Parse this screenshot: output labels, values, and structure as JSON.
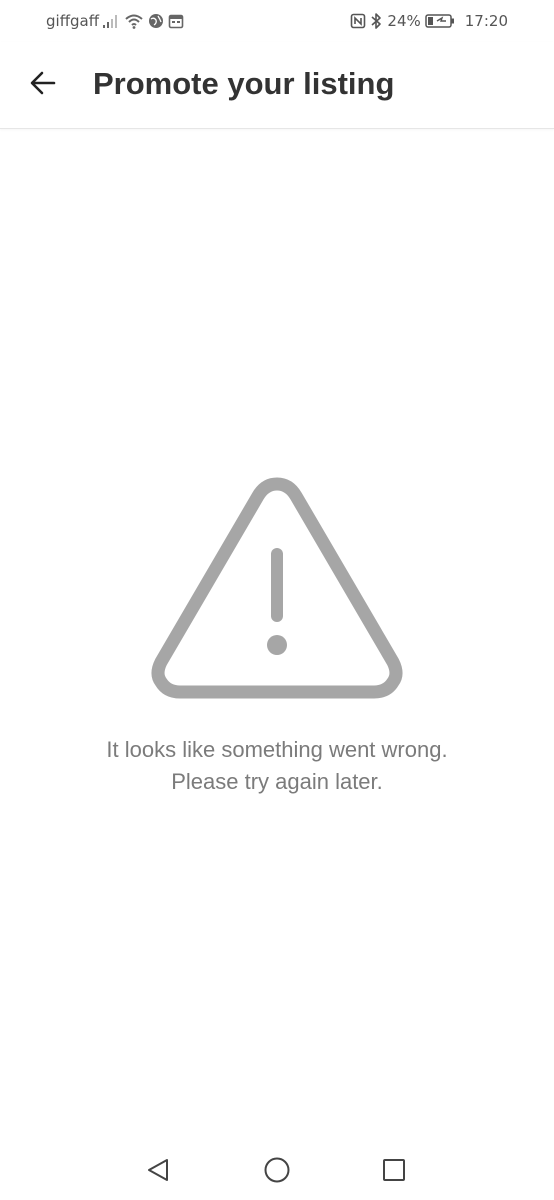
{
  "status_bar": {
    "carrier": "giffgaff",
    "battery_percent": "24%",
    "time": "17:20",
    "icons": [
      "signal-icon",
      "wifi-icon",
      "vpn-globe-icon",
      "calendar-icon",
      "nfc-icon",
      "bluetooth-icon",
      "battery-icon"
    ]
  },
  "app_bar": {
    "back_icon": "arrow-left-icon",
    "title": "Promote your listing"
  },
  "error": {
    "icon": "warning-triangle-icon",
    "line1": "It looks like something went wrong.",
    "line2": "Please try again later."
  },
  "nav_bar": {
    "buttons": [
      "back-triangle-icon",
      "home-circle-icon",
      "recents-square-icon"
    ]
  },
  "colors": {
    "background": "#ffffff",
    "title": "#333333",
    "error_icon": "#a6a6a6",
    "error_text": "#7b7b7b"
  }
}
